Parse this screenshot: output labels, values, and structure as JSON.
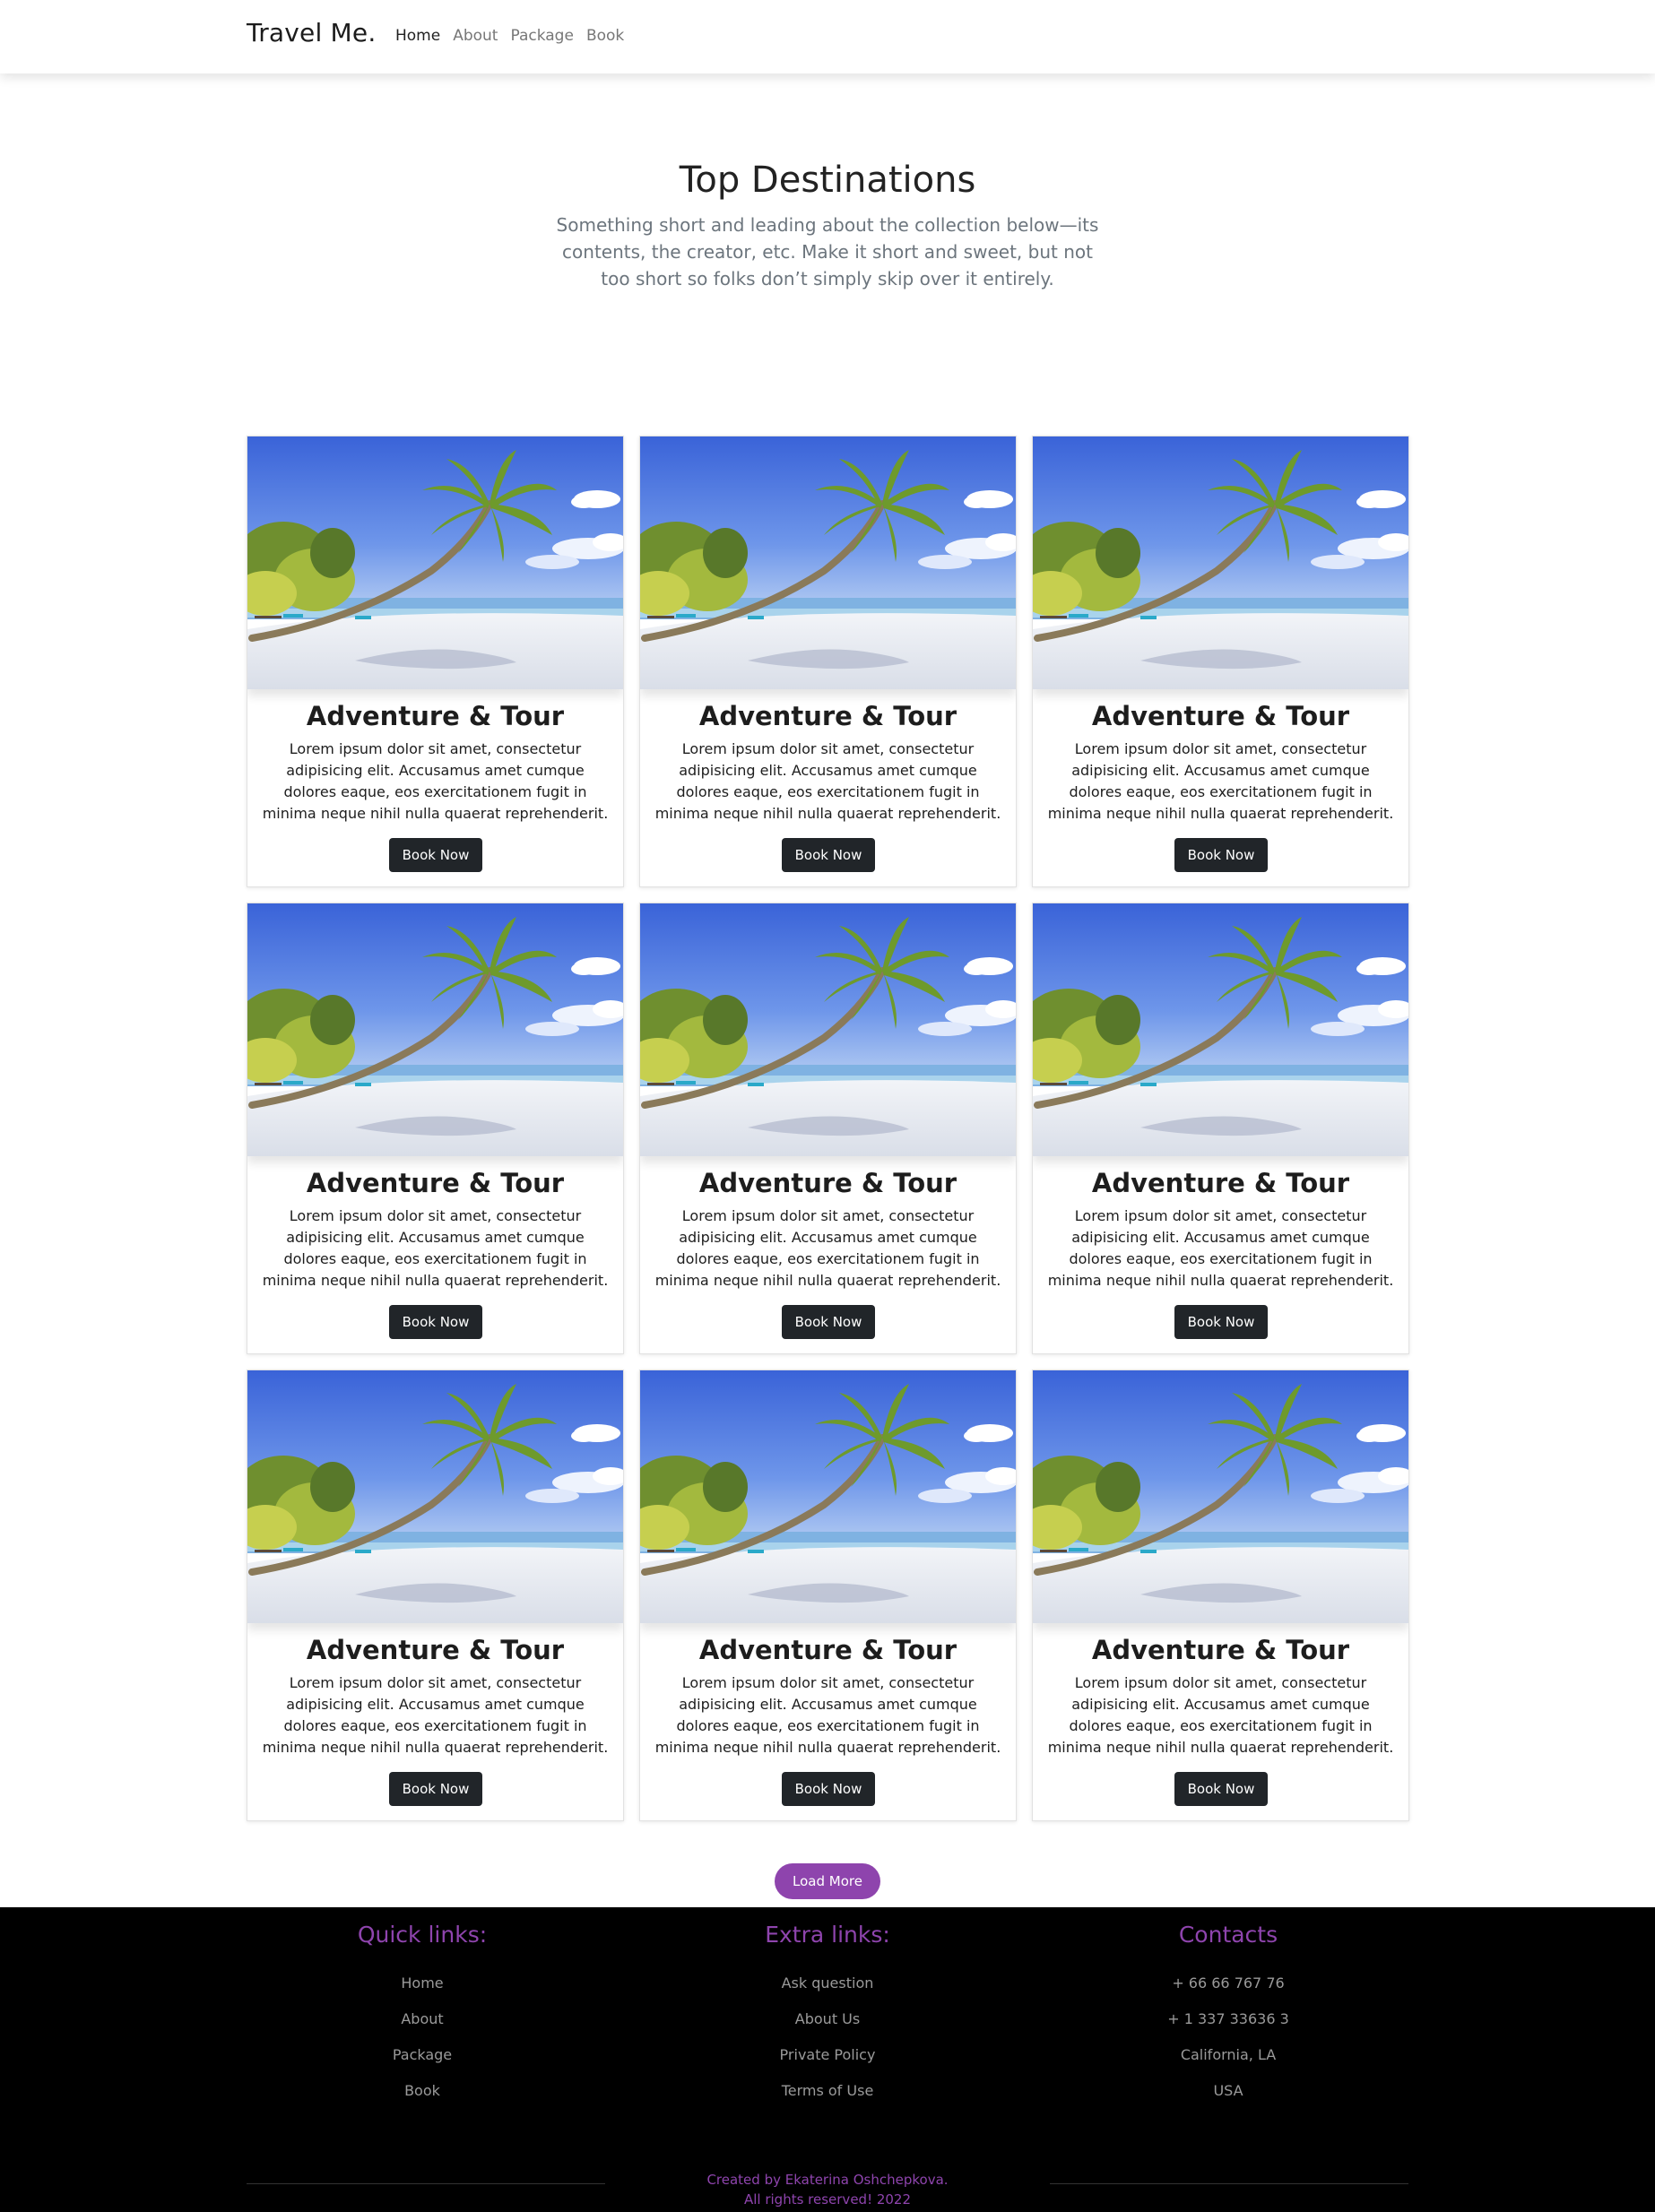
{
  "navbar": {
    "brand": "Travel Me.",
    "links": [
      {
        "label": "Home"
      },
      {
        "label": "About"
      },
      {
        "label": "Package"
      },
      {
        "label": "Book"
      }
    ]
  },
  "hero": {
    "title": "Top Destinations",
    "subtitle": "Something short and leading about the collection below—its contents, the creator, etc. Make it short and sweet, but not too short so folks don’t simply skip over it entirely."
  },
  "cards": [
    {
      "title": "Adventure & Tour",
      "text": "Lorem ipsum dolor sit amet, consectetur adipisicing elit. Accusamus amet cumque dolores eaque, eos exercitationem fugit in minima neque nihil nulla quaerat reprehenderit.",
      "button": "Book Now"
    },
    {
      "title": "Adventure & Tour",
      "text": "Lorem ipsum dolor sit amet, consectetur adipisicing elit. Accusamus amet cumque dolores eaque, eos exercitationem fugit in minima neque nihil nulla quaerat reprehenderit.",
      "button": "Book Now"
    },
    {
      "title": "Adventure & Tour",
      "text": "Lorem ipsum dolor sit amet, consectetur adipisicing elit. Accusamus amet cumque dolores eaque, eos exercitationem fugit in minima neque nihil nulla quaerat reprehenderit.",
      "button": "Book Now"
    },
    {
      "title": "Adventure & Tour",
      "text": "Lorem ipsum dolor sit amet, consectetur adipisicing elit. Accusamus amet cumque dolores eaque, eos exercitationem fugit in minima neque nihil nulla quaerat reprehenderit.",
      "button": "Book Now"
    },
    {
      "title": "Adventure & Tour",
      "text": "Lorem ipsum dolor sit amet, consectetur adipisicing elit. Accusamus amet cumque dolores eaque, eos exercitationem fugit in minima neque nihil nulla quaerat reprehenderit.",
      "button": "Book Now"
    },
    {
      "title": "Adventure & Tour",
      "text": "Lorem ipsum dolor sit amet, consectetur adipisicing elit. Accusamus amet cumque dolores eaque, eos exercitationem fugit in minima neque nihil nulla quaerat reprehenderit.",
      "button": "Book Now"
    },
    {
      "title": "Adventure & Tour",
      "text": "Lorem ipsum dolor sit amet, consectetur adipisicing elit. Accusamus amet cumque dolores eaque, eos exercitationem fugit in minima neque nihil nulla quaerat reprehenderit.",
      "button": "Book Now"
    },
    {
      "title": "Adventure & Tour",
      "text": "Lorem ipsum dolor sit amet, consectetur adipisicing elit. Accusamus amet cumque dolores eaque, eos exercitationem fugit in minima neque nihil nulla quaerat reprehenderit.",
      "button": "Book Now"
    },
    {
      "title": "Adventure & Tour",
      "text": "Lorem ipsum dolor sit amet, consectetur adipisicing elit. Accusamus amet cumque dolores eaque, eos exercitationem fugit in minima neque nihil nulla quaerat reprehenderit.",
      "button": "Book Now"
    }
  ],
  "load_more": "Load More",
  "footer": {
    "quick_links": {
      "title": "Quick links:",
      "items": [
        "Home",
        "About",
        "Package",
        "Book"
      ]
    },
    "extra_links": {
      "title": "Extra links:",
      "items": [
        "Ask question",
        "About Us",
        "Private Policy",
        "Terms of Use"
      ]
    },
    "contacts": {
      "title": "Contacts",
      "items": [
        "+ 66 66 767 76",
        "+ 1 337 33636 3",
        "California, LA",
        "USA"
      ]
    },
    "credit_line1": "Created by Ekaterina Oshchepkova.",
    "credit_line2": "All rights reserved! 2022"
  },
  "colors": {
    "accent": "#8e44ad",
    "button_dark": "#212529",
    "footer_bg": "#000000"
  }
}
